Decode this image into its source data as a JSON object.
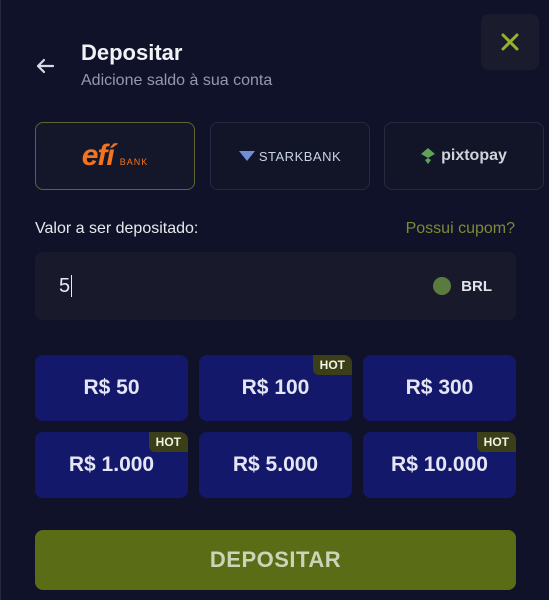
{
  "header": {
    "title": "Depositar",
    "subtitle": "Adicione saldo à sua conta"
  },
  "providers": [
    {
      "name": "efí",
      "sub": "BANK",
      "selected": true
    },
    {
      "name": "STARKBANK",
      "selected": false
    },
    {
      "name": "pixtopay",
      "selected": false
    }
  ],
  "form": {
    "amount_label": "Valor a ser depositado:",
    "coupon_link": "Possui cupom?",
    "amount_value": "5",
    "currency": "BRL"
  },
  "quick_amounts": [
    {
      "label": "R$ 50",
      "hot": false
    },
    {
      "label": "R$ 100",
      "hot": true
    },
    {
      "label": "R$ 300",
      "hot": false
    },
    {
      "label": "R$ 1.000",
      "hot": true
    },
    {
      "label": "R$ 5.000",
      "hot": false
    },
    {
      "label": "R$ 10.000",
      "hot": true
    }
  ],
  "hot_label": "HOT",
  "submit_label": "DEPOSITAR",
  "colors": {
    "accent": "#5a6d16",
    "chip_bg": "#14186a",
    "link": "#7f8a34",
    "efi_orange": "#f37321"
  }
}
